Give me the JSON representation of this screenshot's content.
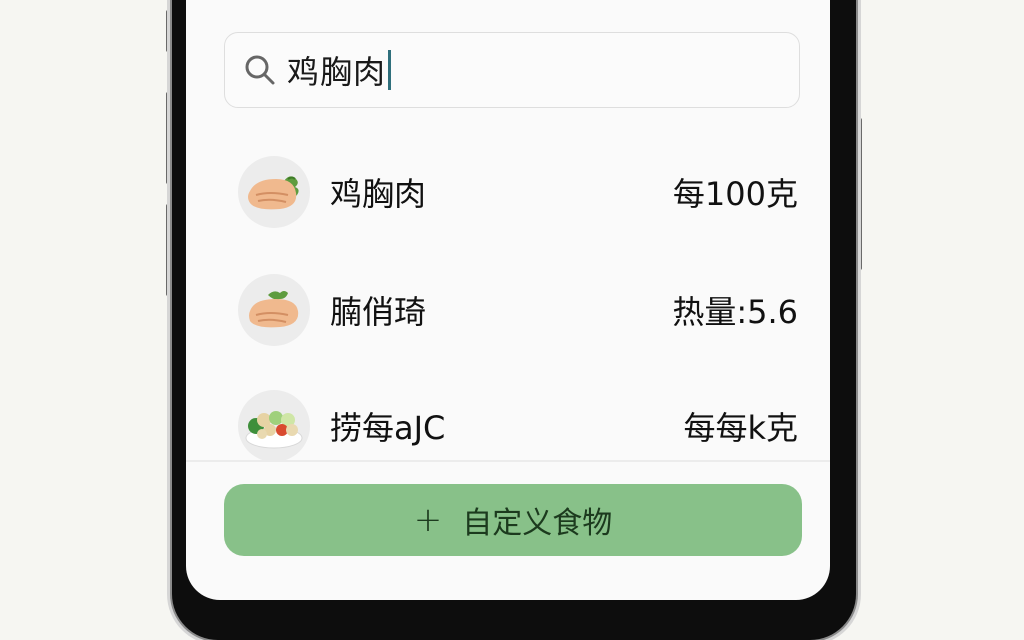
{
  "search": {
    "query": "鸡胸肉"
  },
  "results": [
    {
      "name": "鸡胸肉",
      "meta": "每100克",
      "thumb": "chicken-breast-icon"
    },
    {
      "name": "腩俏琦",
      "meta": "热量:5.6",
      "thumb": "chicken-breast-icon"
    },
    {
      "name": "捞每aJC",
      "meta": "每每k克",
      "thumb": "salad-bowl-icon"
    }
  ],
  "actions": {
    "add_custom": "自定义食物"
  },
  "colors": {
    "accent_button": "#88c189",
    "caret": "#2f6f7c"
  }
}
